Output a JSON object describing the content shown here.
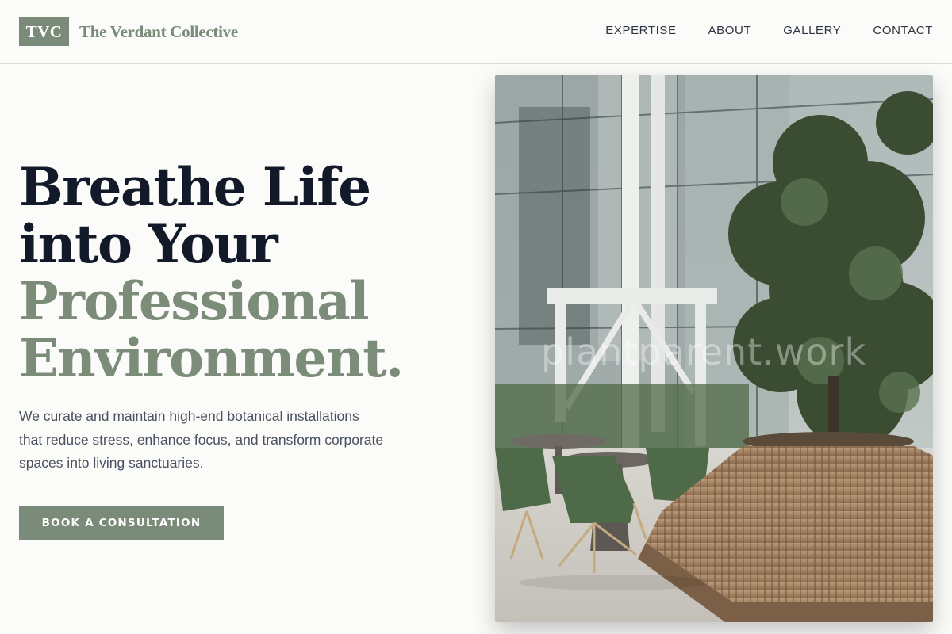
{
  "header": {
    "logo_mark": "TVC",
    "brand_name": "The Verdant Collective",
    "nav": [
      {
        "label": "EXPERTISE"
      },
      {
        "label": "ABOUT"
      },
      {
        "label": "GALLERY"
      },
      {
        "label": "CONTACT"
      }
    ]
  },
  "hero": {
    "headline_lines": [
      {
        "text": "Breathe Life",
        "color": "dark"
      },
      {
        "text": "into Your",
        "color": "dark"
      },
      {
        "text": "Professional",
        "color": "accent"
      },
      {
        "text": "Environment.",
        "color": "accent"
      }
    ],
    "description": "We curate and maintain high-end botanical installations that reduce stress, enhance focus, and transform corporate spaces into living sanctuaries.",
    "cta_label": "BOOK A CONSULTATION"
  },
  "photo": {
    "watermark": "plantparent.work"
  },
  "colors": {
    "accent": "#7a8c79",
    "heading_dark": "#121a2a",
    "body_text": "#4a5261",
    "background": "#fbfbf9"
  }
}
